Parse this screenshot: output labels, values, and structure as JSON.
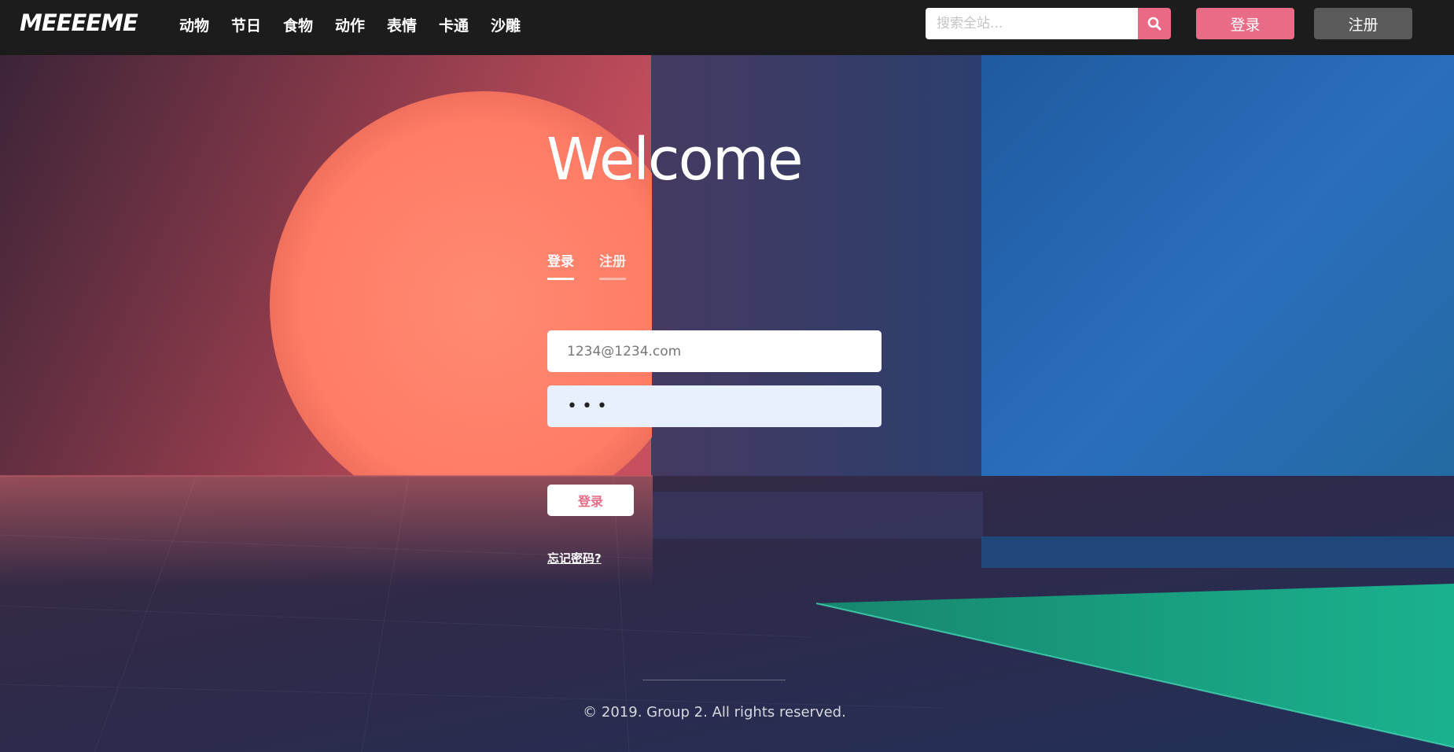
{
  "navbar": {
    "logo": "MEEEEME",
    "links": [
      "动物",
      "节日",
      "食物",
      "动作",
      "表情",
      "卡通",
      "沙雕"
    ],
    "search_placeholder": "搜索全站...",
    "login_label": "登录",
    "register_label": "注册"
  },
  "main": {
    "heading": "Welcome",
    "tabs": [
      {
        "label": "登录",
        "active": true
      },
      {
        "label": "注册",
        "active": false
      }
    ],
    "email_value": "1234@1234.com",
    "password_value": "•••",
    "submit_label": "登录",
    "forgot_label": "忘记密码?"
  },
  "footer": {
    "copyright": "© 2019. Group 2. All rights reserved."
  },
  "colors": {
    "accent": "#e96c86",
    "navbar": "#1c1c1c",
    "register_button": "#5a5a5a",
    "password_field": "#e8f0fd"
  },
  "icons": {
    "search": "search-icon"
  }
}
